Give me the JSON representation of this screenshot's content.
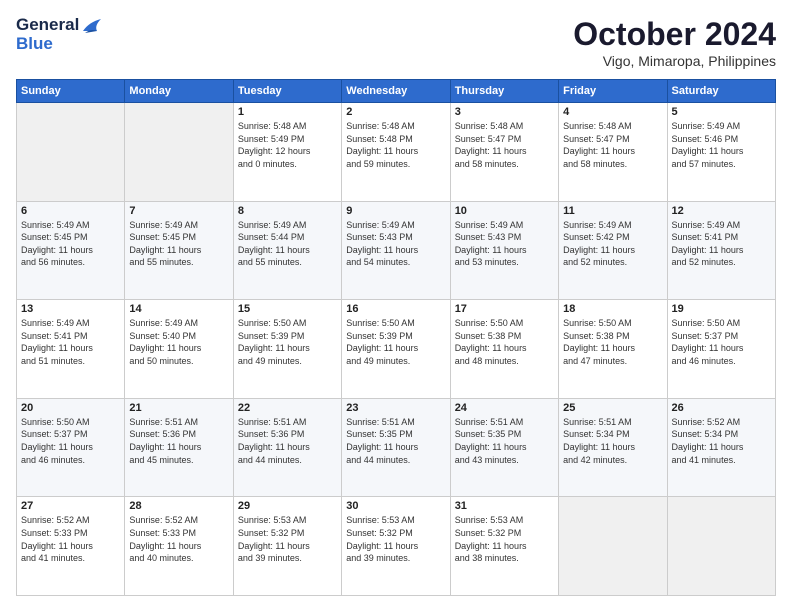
{
  "logo": {
    "line1": "General",
    "line2": "Blue"
  },
  "header": {
    "title": "October 2024",
    "subtitle": "Vigo, Mimaropa, Philippines"
  },
  "weekdays": [
    "Sunday",
    "Monday",
    "Tuesday",
    "Wednesday",
    "Thursday",
    "Friday",
    "Saturday"
  ],
  "rows": [
    [
      {
        "day": "",
        "sunrise": "",
        "sunset": "",
        "daylight": ""
      },
      {
        "day": "",
        "sunrise": "",
        "sunset": "",
        "daylight": ""
      },
      {
        "day": "1",
        "sunrise": "Sunrise: 5:48 AM",
        "sunset": "Sunset: 5:49 PM",
        "daylight": "Daylight: 12 hours and 0 minutes."
      },
      {
        "day": "2",
        "sunrise": "Sunrise: 5:48 AM",
        "sunset": "Sunset: 5:48 PM",
        "daylight": "Daylight: 11 hours and 59 minutes."
      },
      {
        "day": "3",
        "sunrise": "Sunrise: 5:48 AM",
        "sunset": "Sunset: 5:47 PM",
        "daylight": "Daylight: 11 hours and 58 minutes."
      },
      {
        "day": "4",
        "sunrise": "Sunrise: 5:48 AM",
        "sunset": "Sunset: 5:47 PM",
        "daylight": "Daylight: 11 hours and 58 minutes."
      },
      {
        "day": "5",
        "sunrise": "Sunrise: 5:49 AM",
        "sunset": "Sunset: 5:46 PM",
        "daylight": "Daylight: 11 hours and 57 minutes."
      }
    ],
    [
      {
        "day": "6",
        "sunrise": "Sunrise: 5:49 AM",
        "sunset": "Sunset: 5:45 PM",
        "daylight": "Daylight: 11 hours and 56 minutes."
      },
      {
        "day": "7",
        "sunrise": "Sunrise: 5:49 AM",
        "sunset": "Sunset: 5:45 PM",
        "daylight": "Daylight: 11 hours and 55 minutes."
      },
      {
        "day": "8",
        "sunrise": "Sunrise: 5:49 AM",
        "sunset": "Sunset: 5:44 PM",
        "daylight": "Daylight: 11 hours and 55 minutes."
      },
      {
        "day": "9",
        "sunrise": "Sunrise: 5:49 AM",
        "sunset": "Sunset: 5:43 PM",
        "daylight": "Daylight: 11 hours and 54 minutes."
      },
      {
        "day": "10",
        "sunrise": "Sunrise: 5:49 AM",
        "sunset": "Sunset: 5:43 PM",
        "daylight": "Daylight: 11 hours and 53 minutes."
      },
      {
        "day": "11",
        "sunrise": "Sunrise: 5:49 AM",
        "sunset": "Sunset: 5:42 PM",
        "daylight": "Daylight: 11 hours and 52 minutes."
      },
      {
        "day": "12",
        "sunrise": "Sunrise: 5:49 AM",
        "sunset": "Sunset: 5:41 PM",
        "daylight": "Daylight: 11 hours and 52 minutes."
      }
    ],
    [
      {
        "day": "13",
        "sunrise": "Sunrise: 5:49 AM",
        "sunset": "Sunset: 5:41 PM",
        "daylight": "Daylight: 11 hours and 51 minutes."
      },
      {
        "day": "14",
        "sunrise": "Sunrise: 5:49 AM",
        "sunset": "Sunset: 5:40 PM",
        "daylight": "Daylight: 11 hours and 50 minutes."
      },
      {
        "day": "15",
        "sunrise": "Sunrise: 5:50 AM",
        "sunset": "Sunset: 5:39 PM",
        "daylight": "Daylight: 11 hours and 49 minutes."
      },
      {
        "day": "16",
        "sunrise": "Sunrise: 5:50 AM",
        "sunset": "Sunset: 5:39 PM",
        "daylight": "Daylight: 11 hours and 49 minutes."
      },
      {
        "day": "17",
        "sunrise": "Sunrise: 5:50 AM",
        "sunset": "Sunset: 5:38 PM",
        "daylight": "Daylight: 11 hours and 48 minutes."
      },
      {
        "day": "18",
        "sunrise": "Sunrise: 5:50 AM",
        "sunset": "Sunset: 5:38 PM",
        "daylight": "Daylight: 11 hours and 47 minutes."
      },
      {
        "day": "19",
        "sunrise": "Sunrise: 5:50 AM",
        "sunset": "Sunset: 5:37 PM",
        "daylight": "Daylight: 11 hours and 46 minutes."
      }
    ],
    [
      {
        "day": "20",
        "sunrise": "Sunrise: 5:50 AM",
        "sunset": "Sunset: 5:37 PM",
        "daylight": "Daylight: 11 hours and 46 minutes."
      },
      {
        "day": "21",
        "sunrise": "Sunrise: 5:51 AM",
        "sunset": "Sunset: 5:36 PM",
        "daylight": "Daylight: 11 hours and 45 minutes."
      },
      {
        "day": "22",
        "sunrise": "Sunrise: 5:51 AM",
        "sunset": "Sunset: 5:36 PM",
        "daylight": "Daylight: 11 hours and 44 minutes."
      },
      {
        "day": "23",
        "sunrise": "Sunrise: 5:51 AM",
        "sunset": "Sunset: 5:35 PM",
        "daylight": "Daylight: 11 hours and 44 minutes."
      },
      {
        "day": "24",
        "sunrise": "Sunrise: 5:51 AM",
        "sunset": "Sunset: 5:35 PM",
        "daylight": "Daylight: 11 hours and 43 minutes."
      },
      {
        "day": "25",
        "sunrise": "Sunrise: 5:51 AM",
        "sunset": "Sunset: 5:34 PM",
        "daylight": "Daylight: 11 hours and 42 minutes."
      },
      {
        "day": "26",
        "sunrise": "Sunrise: 5:52 AM",
        "sunset": "Sunset: 5:34 PM",
        "daylight": "Daylight: 11 hours and 41 minutes."
      }
    ],
    [
      {
        "day": "27",
        "sunrise": "Sunrise: 5:52 AM",
        "sunset": "Sunset: 5:33 PM",
        "daylight": "Daylight: 11 hours and 41 minutes."
      },
      {
        "day": "28",
        "sunrise": "Sunrise: 5:52 AM",
        "sunset": "Sunset: 5:33 PM",
        "daylight": "Daylight: 11 hours and 40 minutes."
      },
      {
        "day": "29",
        "sunrise": "Sunrise: 5:53 AM",
        "sunset": "Sunset: 5:32 PM",
        "daylight": "Daylight: 11 hours and 39 minutes."
      },
      {
        "day": "30",
        "sunrise": "Sunrise: 5:53 AM",
        "sunset": "Sunset: 5:32 PM",
        "daylight": "Daylight: 11 hours and 39 minutes."
      },
      {
        "day": "31",
        "sunrise": "Sunrise: 5:53 AM",
        "sunset": "Sunset: 5:32 PM",
        "daylight": "Daylight: 11 hours and 38 minutes."
      },
      {
        "day": "",
        "sunrise": "",
        "sunset": "",
        "daylight": ""
      },
      {
        "day": "",
        "sunrise": "",
        "sunset": "",
        "daylight": ""
      }
    ]
  ]
}
